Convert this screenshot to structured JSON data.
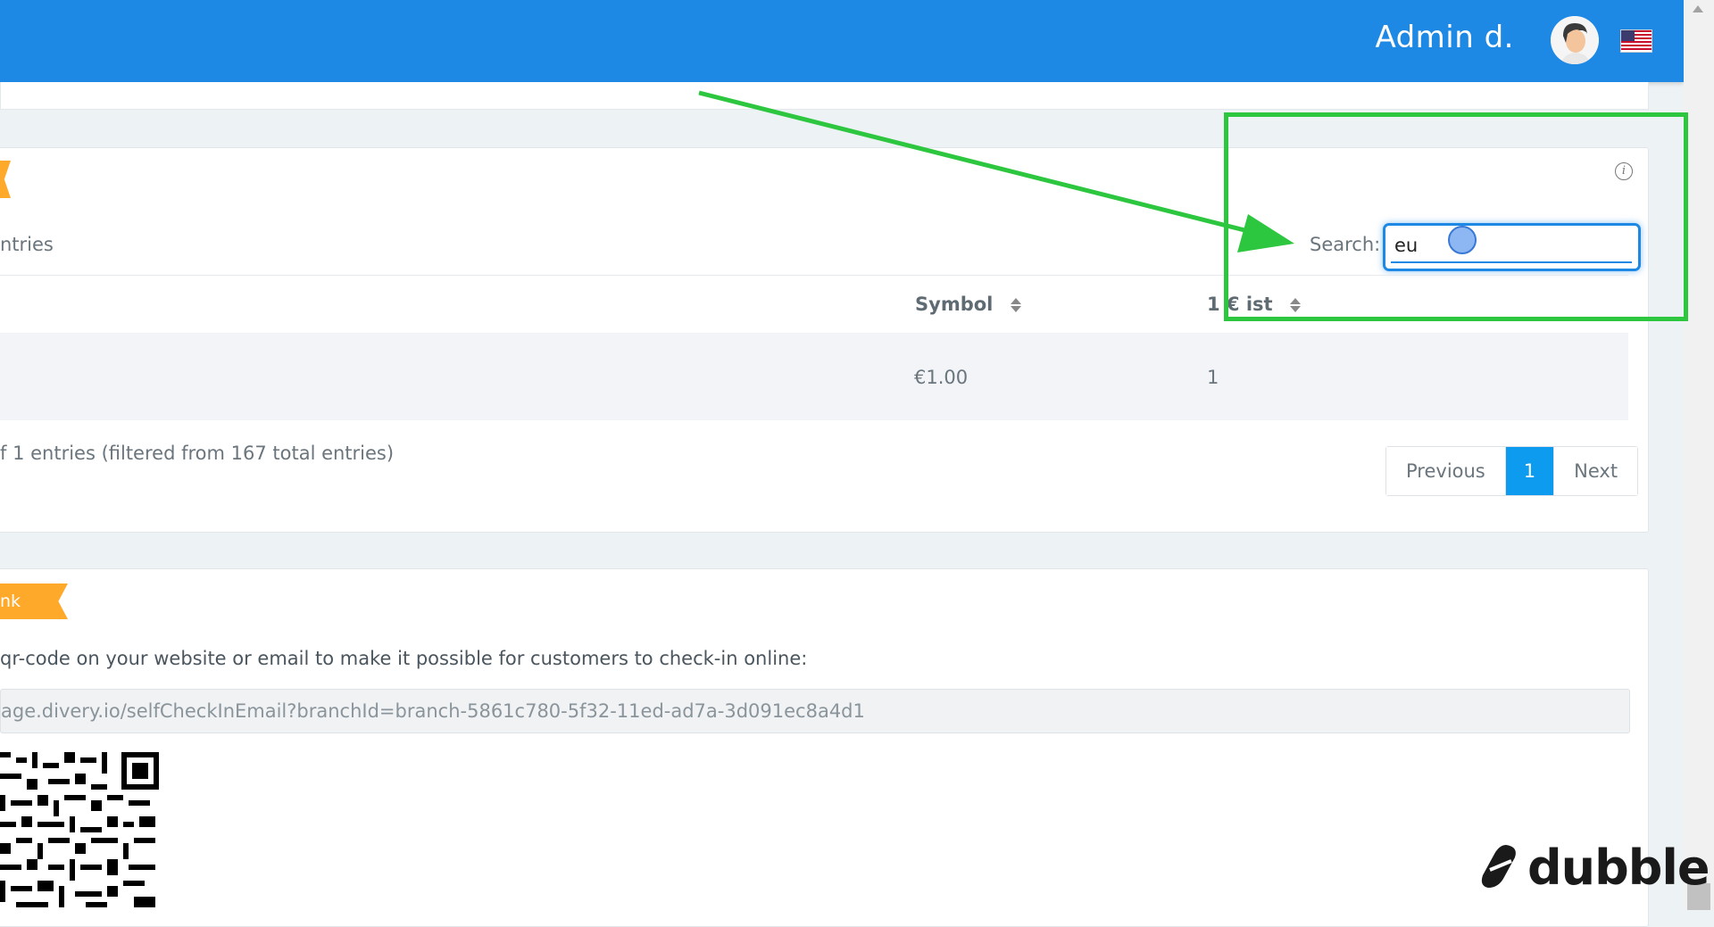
{
  "header": {
    "admin_name": "Admin d.",
    "flag_icon": "us-flag-icon",
    "brand_color": "#1e88e5"
  },
  "table": {
    "entries_label": "ntries",
    "search_label": "Search:",
    "search_value": "eu",
    "columns": [
      "Symbol",
      "1 € ist"
    ],
    "rows": [
      {
        "symbol": "€1.00",
        "rate": "1"
      }
    ],
    "footer_info": "f 1 entries (filtered from 167 total entries)",
    "pagination": {
      "previous": "Previous",
      "page": "1",
      "next": "Next"
    }
  },
  "checkin": {
    "ribbon_label": "nk",
    "description": "qr-code on your website or email to make it possible for customers to check-in online:",
    "url": "age.divery.io/selfCheckInEmail?branchId=branch-5861c780-5f32-11ed-ad7a-3d091ec8a4d1"
  },
  "watermark": {
    "brand": "dubble"
  },
  "annotation_color": "#2dc63f"
}
